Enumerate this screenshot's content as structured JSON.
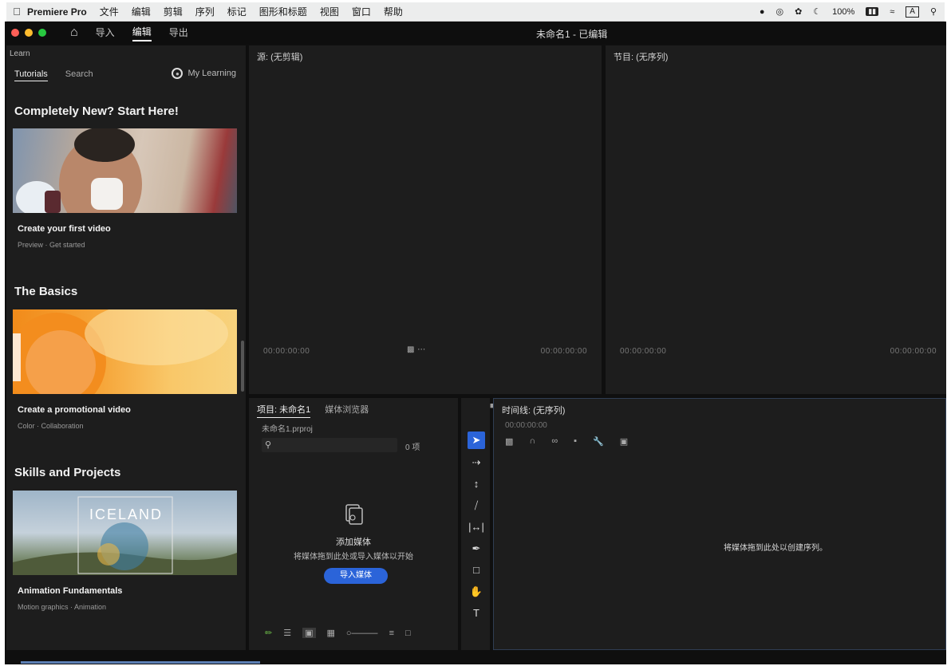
{
  "menubar": {
    "app_name": "Premiere Pro",
    "items": [
      "文件",
      "编辑",
      "剪辑",
      "序列",
      "标记",
      "图形和标题",
      "视图",
      "窗口",
      "帮助"
    ],
    "battery": "100%",
    "input_indicator": "A"
  },
  "window": {
    "tabs": [
      "导入",
      "编辑",
      "导出"
    ],
    "active_tab": "编辑",
    "title": "未命名1 - 已编辑"
  },
  "learn": {
    "header": "Learn",
    "tabs": [
      "Tutorials",
      "Search"
    ],
    "my_learning": "My Learning",
    "sections": [
      {
        "title": "Completely New? Start Here!",
        "card_title": "Create your first video",
        "card_sub": "Preview · Get started"
      },
      {
        "title": "The Basics",
        "card_title": "Create a promotional video",
        "card_sub": "Color · Collaboration"
      },
      {
        "title": "Skills and Projects",
        "card_title": "Animation Fundamentals",
        "card_sub": "Motion graphics · Animation"
      }
    ],
    "card3_overlay": "ICELAND"
  },
  "source": {
    "title": "源: (无剪辑)",
    "tc_left": "00:00:00:00",
    "tc_right": "00:00:00:00"
  },
  "program": {
    "title": "节目: (无序列)",
    "tc_left": "00:00:00:00",
    "tc_right": "00:00:00:00"
  },
  "project": {
    "tabs": [
      "项目: 未命名1",
      "媒体浏览器"
    ],
    "file": "未命名1.prproj",
    "search_placeholder": "",
    "item_count": "0 项",
    "empty_title": "添加媒体",
    "empty_desc": "将媒体拖到此处或导入媒体以开始",
    "import_label": "导入媒体"
  },
  "timeline": {
    "title": "时间线: (无序列)",
    "tc": "00:00:00:00",
    "empty_text": "将媒体拖到此处以创建序列。"
  },
  "colors": {
    "accent": "#2b64d9",
    "panel_bg": "#1d1d1d",
    "app_bg": "#0f0f0f"
  }
}
